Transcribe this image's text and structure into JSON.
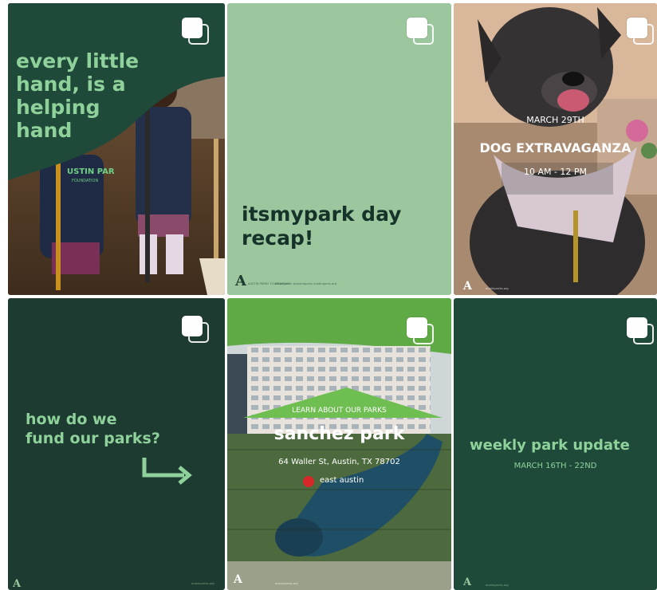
{
  "grid": {
    "tiles": [
      {
        "id": "helping-hand",
        "headline_lines": [
          "every little",
          "hand, is a",
          "helping",
          "hand"
        ],
        "shirt_text": "USTIN PAR",
        "shirt_sub": "FOUNDATION"
      },
      {
        "id": "recap",
        "headline_lines": [
          "itsmypark day",
          "recap!"
        ],
        "logo": "A",
        "logo_sub": "AUSTIN PARKS FOUNDATION",
        "fine_print": "#itsmypark  #austinparks  austinparks.org"
      },
      {
        "id": "dog",
        "date": "MARCH 29TH",
        "title": "DOG EXTRAVAGANZA",
        "time": "10 AM - 12 PM",
        "logo": "A",
        "fine_print": "austinparks.org"
      },
      {
        "id": "fund",
        "headline_lines": [
          "how do we",
          "fund our parks?"
        ],
        "logo": "A",
        "fine_print": "austinparks.org"
      },
      {
        "id": "sanchez",
        "kicker": "LEARN ABOUT OUR PARKS",
        "title": "sanchez park",
        "address": "64 Waller St, Austin, TX 78702",
        "area": "east austin",
        "logo": "A",
        "fine_print": "austinparks.org"
      },
      {
        "id": "weekly",
        "title": "weekly park update",
        "dates": "MARCH 16TH - 22ND",
        "logo": "A",
        "fine_print": "austinparks.org"
      }
    ]
  },
  "colors": {
    "dark_green": "#1d3b30",
    "mid_green": "#1f4a3a",
    "light_green": "#9cc79e",
    "accent_light": "#8fd19a",
    "dark_text": "#16332a",
    "pin_red": "#d62828"
  },
  "icons": {
    "multi_post": "carousel-icon",
    "arrow": "bent-arrow-icon",
    "pin": "location-pin-icon"
  }
}
